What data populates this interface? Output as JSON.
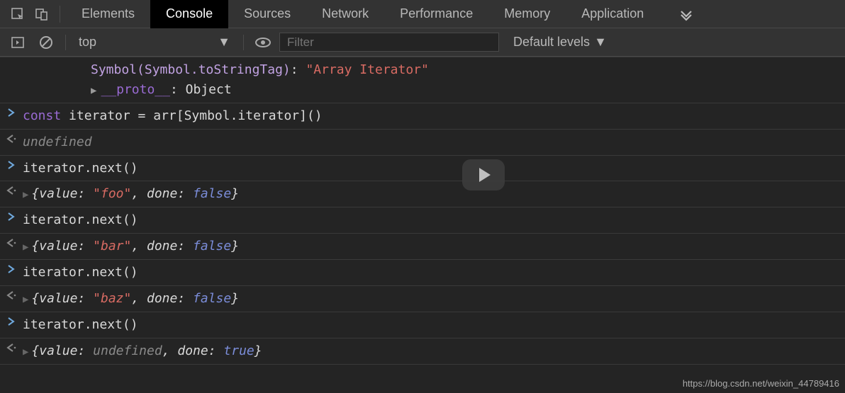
{
  "tabs": {
    "elements": "Elements",
    "console": "Console",
    "sources": "Sources",
    "network": "Network",
    "performance": "Performance",
    "memory": "Memory",
    "application": "Application"
  },
  "toolbar": {
    "context": "top",
    "filter_placeholder": "Filter",
    "levels": "Default levels"
  },
  "preview": {
    "symbol_line_key": "Symbol(Symbol.toStringTag)",
    "symbol_line_val": "\"Array Iterator\"",
    "proto_label": "__proto__",
    "proto_value": "Object"
  },
  "entries": [
    {
      "type": "input",
      "tokens": [
        {
          "cls": "tok-key",
          "t": "const"
        },
        {
          "cls": "tok-plain",
          "t": " iterator = arr[Symbol.iterator]()"
        }
      ]
    },
    {
      "type": "output",
      "tokens": [
        {
          "cls": "tok-undef",
          "t": "undefined"
        }
      ]
    },
    {
      "type": "input",
      "tokens": [
        {
          "cls": "tok-plain",
          "t": "iterator.next()"
        }
      ]
    },
    {
      "type": "output_obj",
      "value_str": "\"foo\"",
      "done_bool": "false"
    },
    {
      "type": "input",
      "tokens": [
        {
          "cls": "tok-plain",
          "t": "iterator.next()"
        }
      ]
    },
    {
      "type": "output_obj",
      "value_str": "\"bar\"",
      "done_bool": "false"
    },
    {
      "type": "input",
      "tokens": [
        {
          "cls": "tok-plain",
          "t": "iterator.next()"
        }
      ]
    },
    {
      "type": "output_obj",
      "value_str": "\"baz\"",
      "done_bool": "false"
    },
    {
      "type": "input",
      "tokens": [
        {
          "cls": "tok-plain",
          "t": "iterator.next()"
        }
      ]
    },
    {
      "type": "output_obj",
      "value_undef": "undefined",
      "done_bool": "true"
    }
  ],
  "watermark": "https://blog.csdn.net/weixin_44789416"
}
